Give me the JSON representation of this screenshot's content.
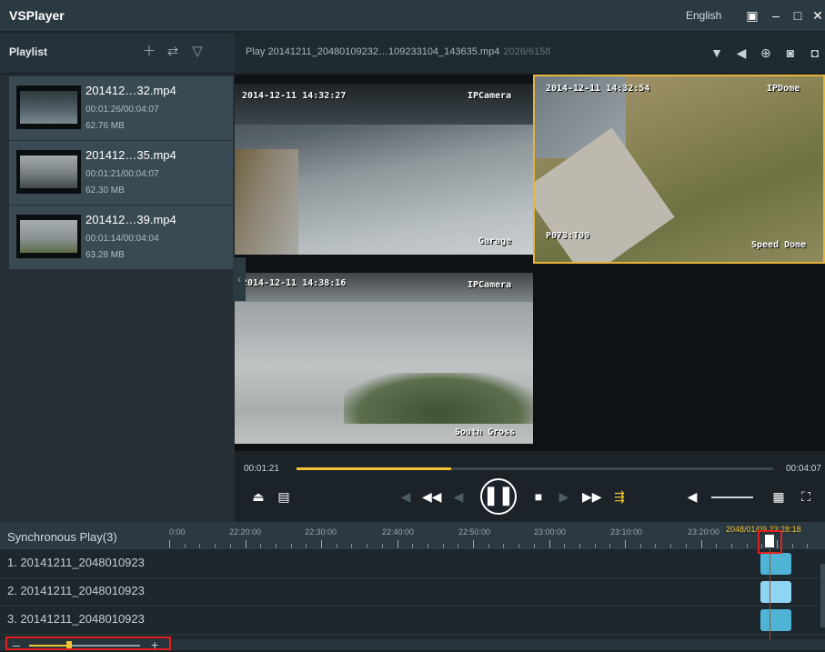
{
  "app": {
    "title": "VSPlayer",
    "language": "English"
  },
  "playlist": {
    "title": "Playlist",
    "items": [
      {
        "name": "201412…32.mp4",
        "time": "00:01:26/00:04:07",
        "size": "62.76 MB"
      },
      {
        "name": "201412…35.mp4",
        "time": "00:01:21/00:04:07",
        "size": "62.30 MB"
      },
      {
        "name": "201412…39.mp4",
        "time": "00:01:14/00:04:04",
        "size": "63.28 MB"
      }
    ]
  },
  "video": {
    "play_title": "Play 20141211_20480109232…109233104_143635.mp4",
    "play_count": "2026/6158",
    "cams": [
      {
        "timestamp": "2014-12-11 14:32:27",
        "name": "IPCamera",
        "label": "Garage"
      },
      {
        "timestamp": "2014-12-11 14:32:54",
        "name": "IPDome",
        "label": "Speed Dome",
        "extra": "P073:T00"
      },
      {
        "timestamp": "2014-12-11 14:38:16",
        "name": "IPCamera",
        "label": "South Gross"
      }
    ]
  },
  "controls": {
    "current_time": "00:01:21",
    "total_time": "00:04:07",
    "progress": 0.325
  },
  "sync": {
    "title": "Synchronous Play(3)",
    "ticks": [
      "0:00",
      "22:20:00",
      "22:30:00",
      "22:40:00",
      "22:50:00",
      "23:00:00",
      "23:10:00",
      "23:20:00"
    ],
    "current_time": "2048/01/09 23:28:18",
    "tracks": [
      {
        "label": "1. 20141211_2048010923",
        "color": "#4fb3d6"
      },
      {
        "label": "2. 20141211_2048010923",
        "color": "#8fd4f2"
      },
      {
        "label": "3. 20141211_2048010923",
        "color": "#4fb3d6"
      }
    ],
    "zoom": 0.36
  },
  "colors": {
    "accent": "#f0c430",
    "highlight_border": "#e5b43b",
    "red_box": "#e0201e"
  }
}
